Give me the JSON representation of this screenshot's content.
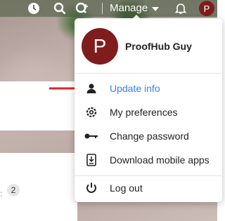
{
  "header": {
    "manage_label": "Manage",
    "avatar_initial": "P"
  },
  "page": {
    "count": "2"
  },
  "user": {
    "name": "ProofHub Guy",
    "initial": "P"
  },
  "menu": {
    "items": [
      {
        "label": "Update info",
        "icon": "user-icon"
      },
      {
        "label": "My preferences",
        "icon": "gear-icon"
      },
      {
        "label": "Change password",
        "icon": "key-icon"
      },
      {
        "label": "Download mobile apps",
        "icon": "mobile-download-icon"
      },
      {
        "label": "Log out",
        "icon": "power-icon"
      }
    ],
    "active_color": "#3b82f6"
  },
  "colors": {
    "avatar": "#7f1d1d",
    "arrow": "#e02424"
  }
}
